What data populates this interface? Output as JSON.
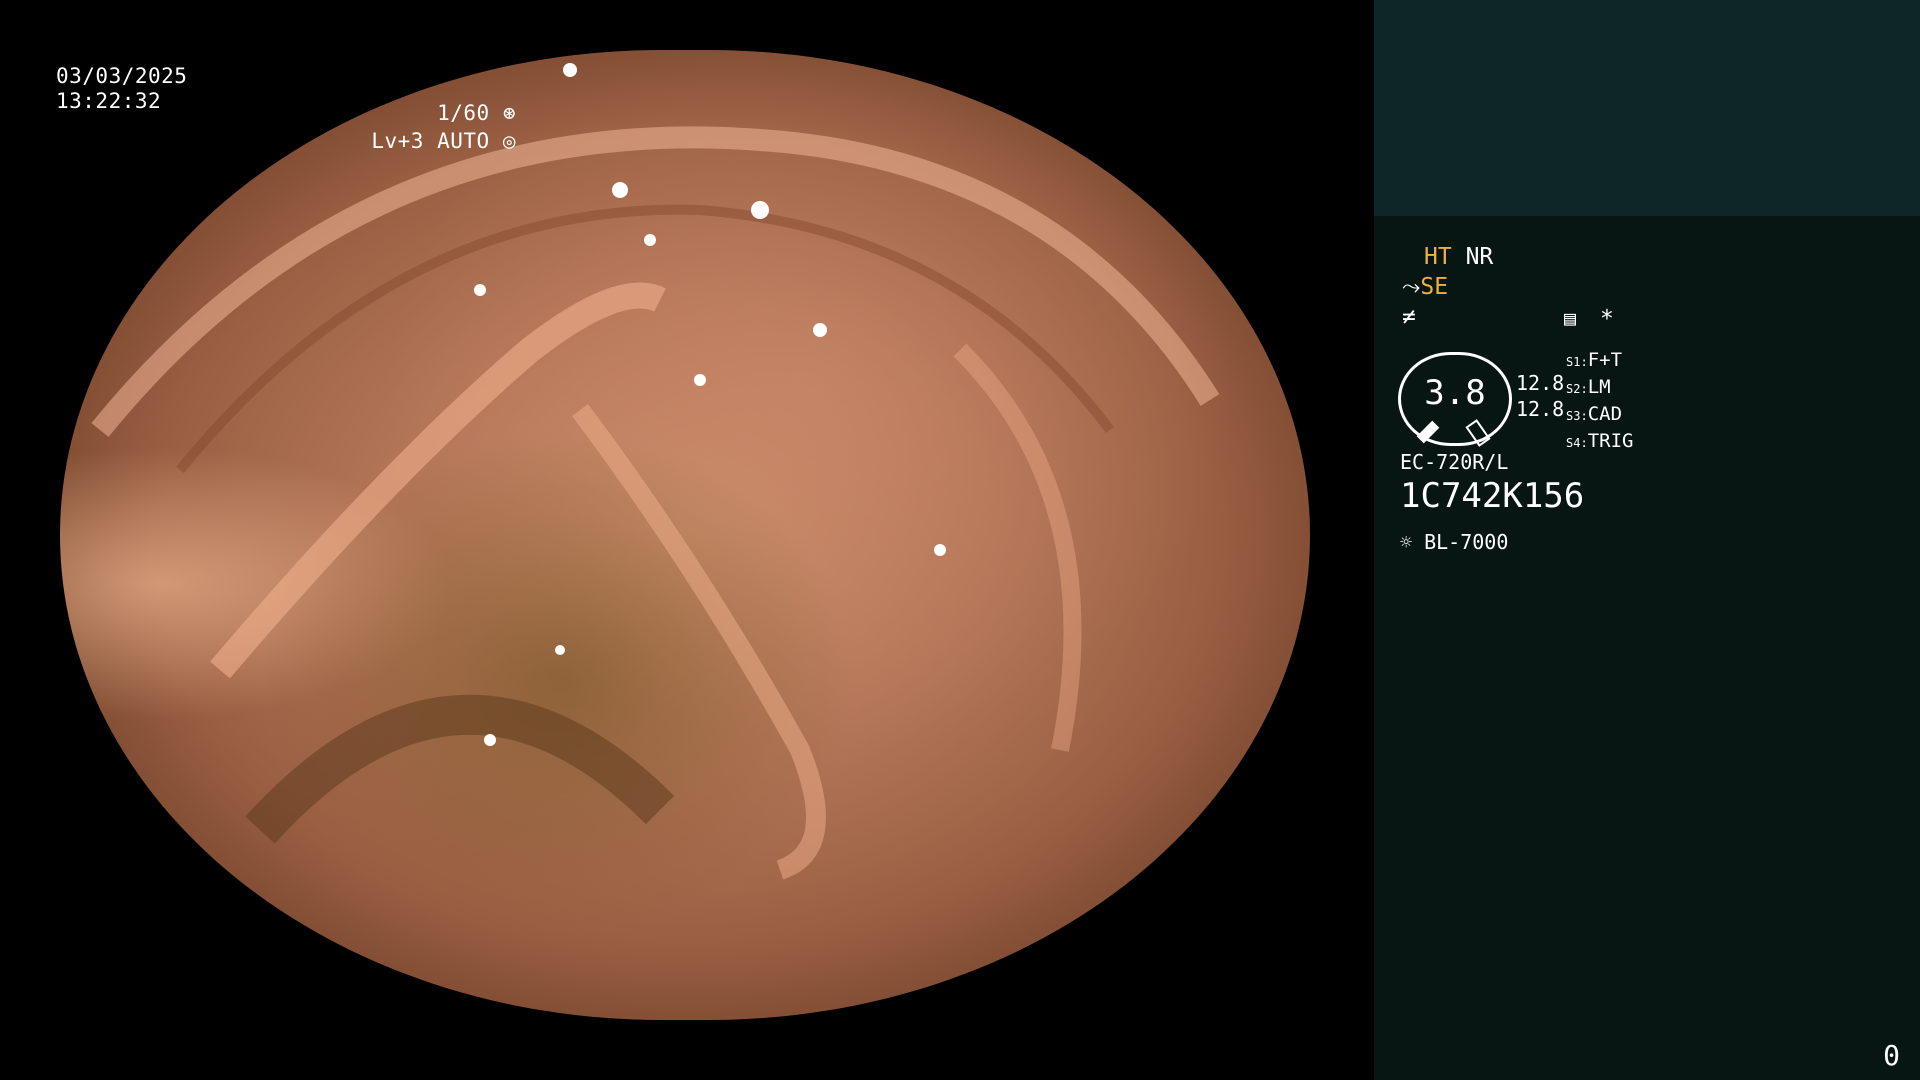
{
  "overlay": {
    "date": "03/03/2025",
    "time": "13:22:32",
    "shutter": "1/60",
    "shutter_icon": "aperture-icon",
    "level": "Lv+3",
    "mode": "AUTO",
    "mode_icon": "auto-iris-icon"
  },
  "panel": {
    "ht_label": "HT",
    "nr_label": "NR",
    "se_label": "SE",
    "se_icon": "scope-arrow-icon",
    "filter_icon": "not-equal-icon",
    "record_icon": "record-icon",
    "asterisk": "*",
    "gauge_value": "3.8",
    "gain_1": "12.8",
    "gain_2": "12.8",
    "switches": [
      {
        "key": "S1",
        "value": "F+T"
      },
      {
        "key": "S2",
        "value": "LM"
      },
      {
        "key": "S3",
        "value": "CAD"
      },
      {
        "key": "S4",
        "value": "TRIG"
      }
    ],
    "scope_model": "EC-720R/L",
    "scope_serial": "1C742K156",
    "light_icon": "light-source-icon",
    "light_source": "BL-7000"
  },
  "frame_counter": "0",
  "colors": {
    "panel_bg": "#071513",
    "panel_top_bg": "#0f2626",
    "accent_yellow": "#f0b040"
  }
}
